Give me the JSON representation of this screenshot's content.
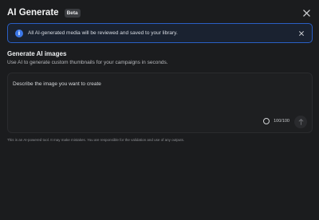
{
  "header": {
    "title": "AI Generate",
    "badge": "Beta"
  },
  "banner": {
    "text": "All AI-generated media will be reviewed and saved to your library."
  },
  "section": {
    "title": "Generate AI images",
    "description": "Use AI to generate custom thumbnails for your campaigns in seconds."
  },
  "prompt": {
    "placeholder": "Describe the image you want to create",
    "value": "",
    "counter": "100/100"
  },
  "disclaimer": "This is an AI-powered tool. It may make mistakes. You are responsible for the validation and use of any outputs.",
  "icons": {
    "close": "close-icon",
    "info": "info-icon",
    "banner_close": "close-icon",
    "counter": "progress-ring-icon",
    "submit": "arrow-up-icon"
  },
  "colors": {
    "accent": "#3b77e8",
    "background": "#1b1c1e",
    "banner_border": "#2a5fc4"
  }
}
